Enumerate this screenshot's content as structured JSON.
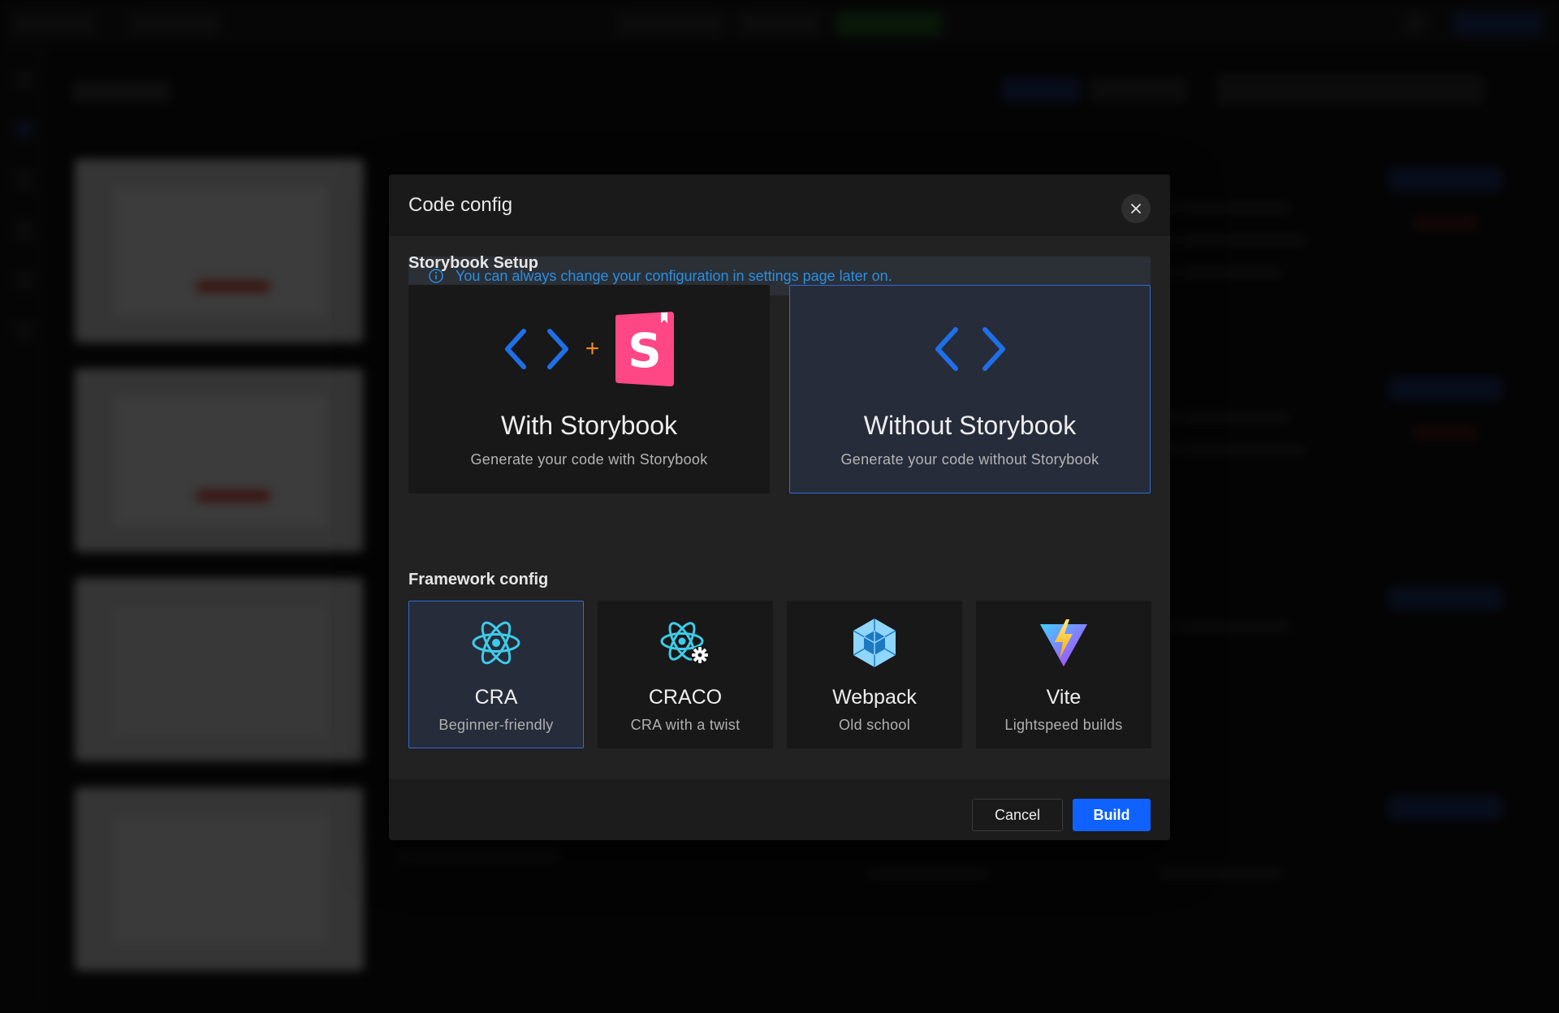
{
  "modal": {
    "title": "Code config",
    "info_text": "You can always change your configuration in settings page later on.",
    "storybook_section_label": "Storybook Setup",
    "framework_section_label": "Framework config",
    "storybook_options": [
      {
        "title": "With Storybook",
        "subtitle": "Generate your code with Storybook",
        "selected": false
      },
      {
        "title": "Without Storybook",
        "subtitle": "Generate your code without Storybook",
        "selected": true
      }
    ],
    "plus_sign": "+",
    "framework_options": [
      {
        "title": "CRA",
        "subtitle": "Beginner-friendly",
        "selected": true,
        "icon": "react-icon"
      },
      {
        "title": "CRACO",
        "subtitle": "CRA with a twist",
        "selected": false,
        "icon": "react-gear-icon"
      },
      {
        "title": "Webpack",
        "subtitle": "Old school",
        "selected": false,
        "icon": "webpack-icon"
      },
      {
        "title": "Vite",
        "subtitle": "Lightspeed builds",
        "selected": false,
        "icon": "vite-icon"
      }
    ],
    "cancel_label": "Cancel",
    "build_label": "Build"
  },
  "colors": {
    "accent": "#0f62fe",
    "selected_border": "#2f6ad8",
    "info_text": "#2a8fe0",
    "storybook_pink": "#ff4785",
    "plus_orange": "#f0891e"
  }
}
